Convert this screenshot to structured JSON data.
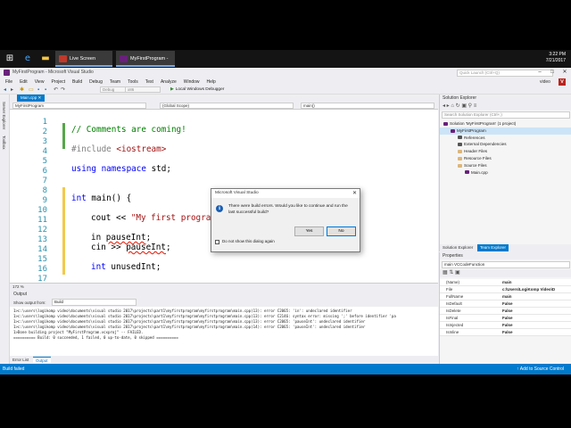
{
  "taskbar": {
    "apps": [
      "Live Screen Capture",
      "MyFirstProgram - M..."
    ],
    "clock_time": "3:22 PM",
    "clock_date": "7/21/2017"
  },
  "titlebar": {
    "title": "MyFirstProgram - Microsoft Visual Studio",
    "quick_launch_placeholder": "Quick Launch (Ctrl+Q)"
  },
  "menu": {
    "items": [
      "File",
      "Edit",
      "View",
      "Project",
      "Build",
      "Debug",
      "Team",
      "Tools",
      "Test",
      "Analyze",
      "Window",
      "Help"
    ],
    "user": "video",
    "avatar_letter": "V"
  },
  "toolbar": {
    "config": "Debug",
    "platform": "x86",
    "run_label": "Local Windows Debugger"
  },
  "siderail": {
    "tabs": [
      "Server Explorer",
      "Toolbox"
    ]
  },
  "editor": {
    "tab": "Main.cpp",
    "nav_project": "MyFirstProgram",
    "nav_scope": "(Global Scope)",
    "nav_member": "main()",
    "zoom": "172 %",
    "lines": [
      {
        "n": "1",
        "text": ""
      },
      {
        "n": "2",
        "text": "// Comments are coming!"
      },
      {
        "n": "3",
        "text": ""
      },
      {
        "n": "4",
        "text": "#include <iostream>"
      },
      {
        "n": "5",
        "text": ""
      },
      {
        "n": "6",
        "text": "using namespace std;"
      },
      {
        "n": "7",
        "text": ""
      },
      {
        "n": "8",
        "text": ""
      },
      {
        "n": "9",
        "text": "int main() {"
      },
      {
        "n": "10",
        "text": ""
      },
      {
        "n": "11",
        "text": "cout << \"My first program"
      },
      {
        "n": "12",
        "text": ""
      },
      {
        "n": "13",
        "text": "in pauseInt;"
      },
      {
        "n": "14",
        "text": "cin >> pauseInt;"
      },
      {
        "n": "15",
        "text": ""
      },
      {
        "n": "16",
        "text": "int unusedInt;"
      },
      {
        "n": "17",
        "text": ""
      }
    ]
  },
  "output": {
    "title": "Output",
    "show_from_label": "Show output from:",
    "show_from_value": "Build",
    "lines": [
      "1>c:\\users\\logikomp video\\documents\\visual studio 2017\\projects\\part1\\myfirstprogram\\myfirstprogram\\main.cpp(13): error C2065: 'in': undeclared identifier",
      "1>c:\\users\\logikomp video\\documents\\visual studio 2017\\projects\\part1\\myfirstprogram\\myfirstprogram\\main.cpp(13): error C2146: syntax error: missing ';' before identifier 'pa",
      "1>c:\\users\\logikomp video\\documents\\visual studio 2017\\projects\\part1\\myfirstprogram\\myfirstprogram\\main.cpp(13): error C2065: 'pauseInt': undeclared identifier",
      "1>c:\\users\\logikomp video\\documents\\visual studio 2017\\projects\\part1\\myfirstprogram\\myfirstprogram\\main.cpp(14): error C2065: 'pauseInt': undeclared identifier",
      "1>Done building project \"MyFirstProgram.vcxproj\" -- FAILED.",
      "========== Build: 0 succeeded, 1 failed, 0 up-to-date, 0 skipped =========="
    ],
    "tabs": [
      "Error List",
      "Output"
    ]
  },
  "solution_explorer": {
    "title": "Solution Explorer",
    "search_placeholder": "Search Solution Explorer (Ctrl+;)",
    "items": [
      {
        "label": "Solution 'MyFirstProgram' (1 project)",
        "indent": 0,
        "color": "#68217a"
      },
      {
        "label": "MyFirstProgram",
        "indent": 1,
        "color": "#68217a",
        "selected": true
      },
      {
        "label": "References",
        "indent": 2,
        "color": "#555555"
      },
      {
        "label": "External Dependencies",
        "indent": 2,
        "color": "#555555"
      },
      {
        "label": "Header Files",
        "indent": 2,
        "color": "#dcb67a"
      },
      {
        "label": "Resource Files",
        "indent": 2,
        "color": "#dcb67a"
      },
      {
        "label": "Source Files",
        "indent": 2,
        "color": "#dcb67a"
      },
      {
        "label": "Main.cpp",
        "indent": 3,
        "color": "#68217a"
      }
    ],
    "tabs": [
      "Solution Explorer",
      "Team Explorer"
    ]
  },
  "properties": {
    "title": "Properties",
    "object": "main VCCodeFunction",
    "rows": [
      {
        "k": "(Name)",
        "v": "main"
      },
      {
        "k": "File",
        "v": "c:\\Users\\LogiKomp Video\\D"
      },
      {
        "k": "FullName",
        "v": "main"
      },
      {
        "k": "IsDefault",
        "v": "False"
      },
      {
        "k": "IsDelete",
        "v": "False"
      },
      {
        "k": "IsFinal",
        "v": "False"
      },
      {
        "k": "IsInjected",
        "v": "False"
      },
      {
        "k": "IsInline",
        "v": "False"
      }
    ]
  },
  "status": {
    "left": "Build failed",
    "right": "Add to Source Control"
  },
  "dialog": {
    "title": "Microsoft Visual Studio",
    "message": "There were build errors. Would you like to continue and run the last successful build?",
    "yes": "Yes",
    "no": "No",
    "checkbox": "Do not show this dialog again"
  }
}
